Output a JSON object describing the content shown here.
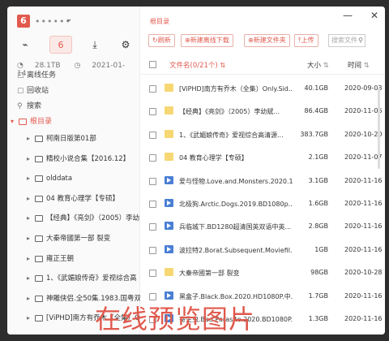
{
  "app": {
    "logo_char": "6",
    "username": "••••••"
  },
  "sidebar": {
    "tab_count": "6",
    "storage": "28.1TB",
    "date": "2021-01-14",
    "nav": [
      {
        "label": "离线任务"
      },
      {
        "label": "回收站"
      },
      {
        "label": "搜索"
      }
    ],
    "root_label": "根目录",
    "tree": [
      {
        "label": "柯南日版第01部"
      },
      {
        "label": "精校小说合集【2016.12】"
      },
      {
        "label": "olddata"
      },
      {
        "label": "04 教育心理学【专硕】"
      },
      {
        "label": "【经典】《亮剑》（2005）李幼"
      },
      {
        "label": "大秦帝國第一部 裂变"
      },
      {
        "label": "雍正王朝"
      },
      {
        "label": "1、《武媚娘传奇》爱视综合高"
      },
      {
        "label": "神雕侠侣.全50集.1983.国粤双语"
      },
      {
        "label": "[ViPHD]南方有乔木（全集）Only"
      }
    ]
  },
  "main": {
    "breadcrumb": "根目录",
    "toolbar": {
      "refresh": "刷新",
      "new_offline": "新建离线下载",
      "new_folder": "新建文件夹",
      "upload": "上传",
      "search_placeholder": "搜索文件"
    },
    "header": {
      "name": "文件名(0/21个)",
      "size": "大小",
      "time": "时间"
    },
    "files": [
      {
        "type": "folder",
        "name": "[ViPHD]南方有乔木（全集）Only.Sid...",
        "size": "40.1GB",
        "time": "2020-09-03"
      },
      {
        "type": "folder",
        "name": "【经典】《亮剑》（2005）李幼斌...",
        "size": "86.4GB",
        "time": "2020-11-06"
      },
      {
        "type": "folder",
        "name": "1、《武媚娘传奇》爱视综合高清源...",
        "size": "383.7GB",
        "time": "2020-10-20"
      },
      {
        "type": "folder",
        "name": "04 教育心理学【专硕】",
        "size": "2.1GB",
        "time": "2020-11-07"
      },
      {
        "type": "video",
        "name": "爱与怪物.Love.and.Monsters.2020.1...",
        "size": "3.1GB",
        "time": "2020-11-16"
      },
      {
        "type": "video",
        "name": "北极狗.Arctic.Dogs.2019.BD1080p....",
        "size": "1.6GB",
        "time": "2020-11-16"
      },
      {
        "type": "video",
        "name": "兵临城下.BD1280超清国英双语中英...",
        "size": "2.8GB",
        "time": "2020-11-16"
      },
      {
        "type": "video",
        "name": "波拉特2.Borat.Subsequent.Moviefil...",
        "size": "1GB",
        "time": "2020-11-16"
      },
      {
        "type": "folder",
        "name": "大秦帝國第一部 裂变",
        "size": "98GB",
        "time": "2020-10-28"
      },
      {
        "type": "video",
        "name": "黑盒子.Black.Box.2020.HD1080P.中...",
        "size": "1.7GB",
        "time": "2020-11-16"
      },
      {
        "type": "video",
        "name": "寄生虫.Bad.Parasite.2020.BD1080P....",
        "size": "1.3GB",
        "time": "2020-11-16"
      }
    ]
  },
  "overlay_text": "在线预览图片"
}
